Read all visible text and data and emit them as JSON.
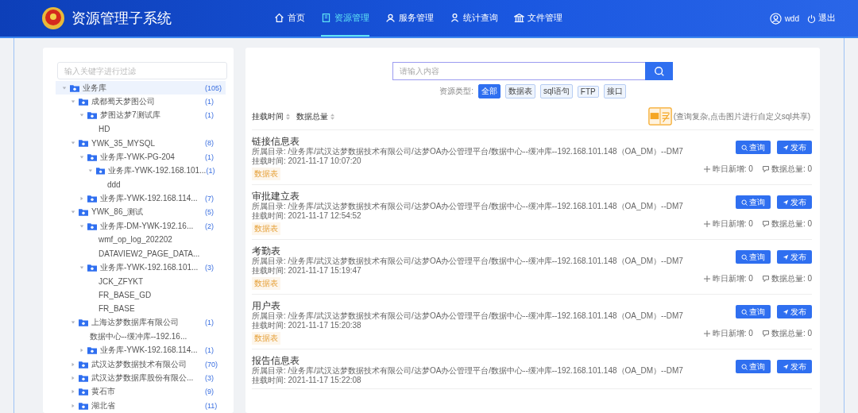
{
  "header": {
    "title": "资源管理子系统",
    "nav": [
      {
        "label": "首页",
        "selected": false
      },
      {
        "label": "资源管理",
        "selected": true
      },
      {
        "label": "服务管理",
        "selected": false
      },
      {
        "label": "统计查询",
        "selected": false
      },
      {
        "label": "文件管理",
        "selected": false
      }
    ],
    "user": "wdd",
    "logout": "退出"
  },
  "tree": {
    "placeholder": "输入关键字进行过滤",
    "items": [
      {
        "label": "业务库",
        "count": "(105)",
        "expanded": true,
        "selected": true,
        "children": [
          {
            "label": "成都蜀天梦图公司",
            "count": "(1)",
            "expanded": true,
            "selected": false,
            "children": [
              {
                "label": "梦图达梦7测试库",
                "count": "(1)",
                "expanded": true,
                "selected": false,
                "children": [
                  {
                    "label": "HD",
                    "selected": false
                  }
                ]
              }
            ]
          },
          {
            "label": "YWK_35_MYSQL",
            "count": "(8)",
            "expanded": true,
            "selected": false,
            "children": [
              {
                "label": "业务库-YWK-PG-204",
                "count": "(1)",
                "expanded": true,
                "selected": false,
                "children": [
                  {
                    "label": "业务库-YWK-192.168.101...",
                    "count": "(1)",
                    "expanded": true,
                    "selected": false,
                    "children": [
                      {
                        "label": "ddd",
                        "selected": false
                      }
                    ]
                  }
                ]
              },
              {
                "label": "业务库-YWK-192.168.114...",
                "count": "(7)",
                "expanded": false,
                "selected": false
              }
            ]
          },
          {
            "label": "YWK_86_测试",
            "count": "(5)",
            "expanded": true,
            "selected": false,
            "children": [
              {
                "label": "业务库-DM-YWK-192.16...",
                "count": "(2)",
                "expanded": true,
                "selected": false,
                "children": [
                  {
                    "label": "wmf_op_log_202202",
                    "selected": false
                  },
                  {
                    "label": "DATAVIEW2_PAGE_DATA...",
                    "selected": false
                  }
                ]
              },
              {
                "label": "业务库-YWK-192.168.101...",
                "count": "(3)",
                "expanded": true,
                "selected": false,
                "children": [
                  {
                    "label": "JCK_ZFYKT",
                    "selected": false
                  },
                  {
                    "label": "FR_BASE_GD",
                    "selected": false
                  },
                  {
                    "label": "FR_BASE",
                    "selected": false
                  }
                ]
              }
            ]
          },
          {
            "label": "上海达梦数据库有限公司",
            "count": "(1)",
            "expanded": true,
            "selected": false,
            "children": [
              {
                "label": "数据中心--缓冲库--192.16...",
                "selected": false
              },
              {
                "label": "业务库-YWK-192.168.114...",
                "count": "(1)",
                "expanded": false,
                "selected": false
              }
            ]
          },
          {
            "label": "武汉达梦数据技术有限公司",
            "count": "(70)",
            "expanded": false,
            "selected": false
          },
          {
            "label": "武汉达梦数据库股份有限公...",
            "count": "(3)",
            "expanded": false,
            "selected": false
          },
          {
            "label": "黄石市",
            "count": "(9)",
            "expanded": false,
            "selected": false
          },
          {
            "label": "湖北省",
            "count": "(11)",
            "expanded": false,
            "selected": false
          }
        ]
      }
    ]
  },
  "search": {
    "placeholder": "请输入内容"
  },
  "types": {
    "label": "资源类型:",
    "options": [
      {
        "label": "全部",
        "selected": true
      },
      {
        "label": "数据表",
        "selected": false
      },
      {
        "label": "sql语句",
        "selected": false
      },
      {
        "label": "FTP",
        "selected": false
      },
      {
        "label": "接口",
        "selected": false
      }
    ]
  },
  "sort": [
    "挂载时间",
    "数据总量"
  ],
  "sql_hint": "(查询复杂,点击图片进行自定义sql共享)",
  "records": [
    {
      "title": "链接信息表",
      "path": "所属目录: /业务库/武汉达梦数据技术有限公司/达梦OA办公管理平台/数据中心--缓冲库--192.168.101.148（OA_DM）--DM7",
      "time": "挂载时间: 2021-11-17 10:07:20",
      "tag": "数据表",
      "query": "查询",
      "publish": "发布",
      "new": "昨日新增: 0",
      "total": "数据总量: 0"
    },
    {
      "title": "审批建立表",
      "path": "所属目录: /业务库/武汉达梦数据技术有限公司/达梦OA办公管理平台/数据中心--缓冲库--192.168.101.148（OA_DM）--DM7",
      "time": "挂载时间: 2021-11-17 12:54:52",
      "tag": "数据表",
      "query": "查询",
      "publish": "发布",
      "new": "昨日新增: 0",
      "total": "数据总量: 0"
    },
    {
      "title": "考勤表",
      "path": "所属目录: /业务库/武汉达梦数据技术有限公司/达梦OA办公管理平台/数据中心--缓冲库--192.168.101.148（OA_DM）--DM7",
      "time": "挂载时间: 2021-11-17 15:19:47",
      "tag": "数据表",
      "query": "查询",
      "publish": "发布",
      "new": "昨日新增: 0",
      "total": "数据总量: 0"
    },
    {
      "title": "用户表",
      "path": "所属目录: /业务库/武汉达梦数据技术有限公司/达梦OA办公管理平台/数据中心--缓冲库--192.168.101.148（OA_DM）--DM7",
      "time": "挂载时间: 2021-11-17 15:20:38",
      "tag": "数据表",
      "query": "查询",
      "publish": "发布",
      "new": "昨日新增: 0",
      "total": "数据总量: 0"
    },
    {
      "title": "报告信息表",
      "path": "所属目录: /业务库/武汉达梦数据技术有限公司/达梦OA办公管理平台/数据中心--缓冲库--192.168.101.148（OA_DM）--DM7",
      "time": "挂载时间: 2021-11-17 15:22:08",
      "query": "查询",
      "publish": "发布"
    }
  ]
}
